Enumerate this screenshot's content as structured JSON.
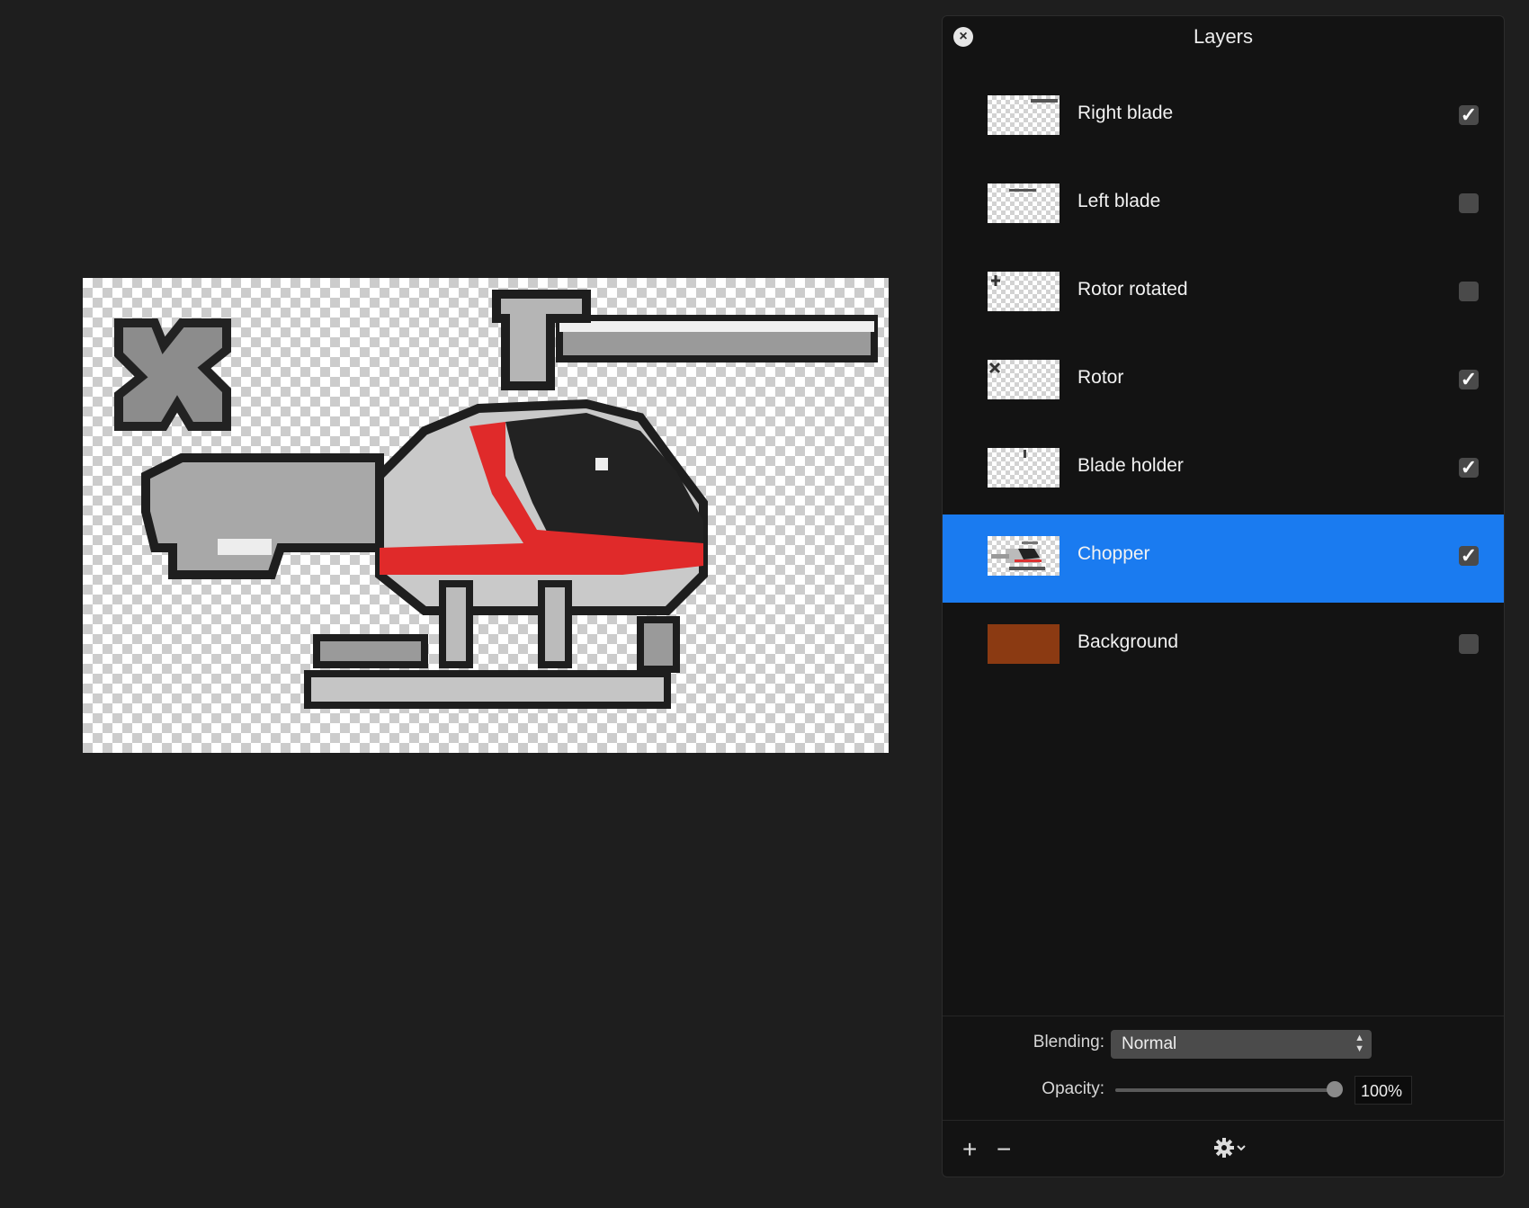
{
  "panel": {
    "title": "Layers",
    "close_icon": "close-icon"
  },
  "layers": [
    {
      "name": "Right blade",
      "visible": true,
      "selected": false,
      "thumb": "right-blade"
    },
    {
      "name": "Left blade",
      "visible": false,
      "selected": false,
      "thumb": "left-blade"
    },
    {
      "name": "Rotor rotated",
      "visible": false,
      "selected": false,
      "thumb": "rotor-rotated"
    },
    {
      "name": "Rotor",
      "visible": true,
      "selected": false,
      "thumb": "rotor"
    },
    {
      "name": "Blade holder",
      "visible": true,
      "selected": false,
      "thumb": "blade-holder"
    },
    {
      "name": "Chopper",
      "visible": true,
      "selected": true,
      "thumb": "chopper"
    },
    {
      "name": "Background",
      "visible": false,
      "selected": false,
      "thumb": "background"
    }
  ],
  "properties": {
    "blending_label": "Blending:",
    "blending_value": "Normal",
    "opacity_label": "Opacity:",
    "opacity_value": "100%",
    "opacity_fraction": 1.0
  },
  "toolbar": {
    "add_label": "+",
    "remove_label": "−",
    "settings_icon": "gear-icon"
  },
  "colors": {
    "selection": "#1a7bf0",
    "background_layer": "#8b3a12",
    "chopper_red": "#e02a2a"
  }
}
